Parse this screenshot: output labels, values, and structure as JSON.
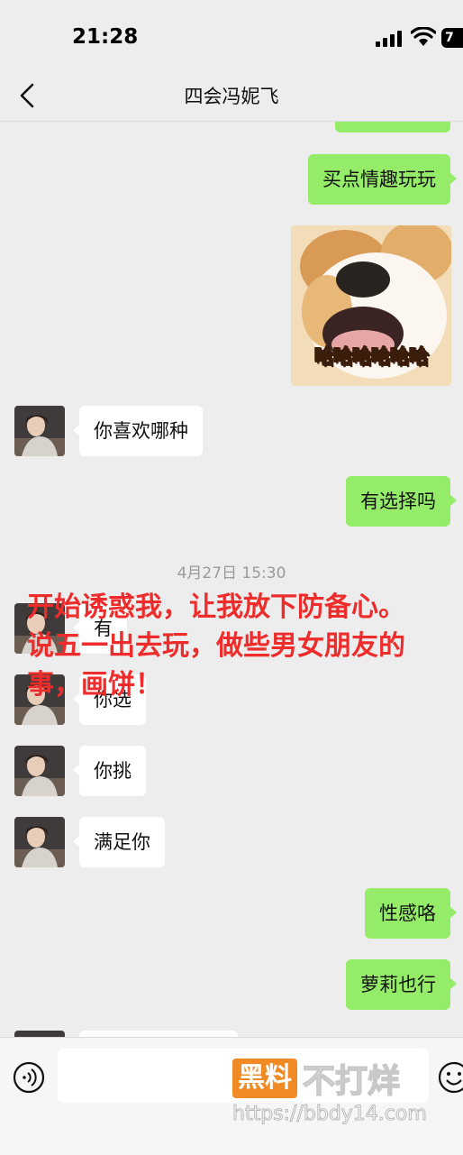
{
  "status_bar": {
    "time": "21:28",
    "battery": "7"
  },
  "header": {
    "title": "四会冯妮飞"
  },
  "messages": [
    {
      "side": "me",
      "text": "买点情趣玩玩"
    },
    {
      "side": "other",
      "text": "你喜欢哪种"
    },
    {
      "side": "me",
      "text": "有选择吗"
    },
    {
      "side": "other",
      "text": "有"
    },
    {
      "side": "other",
      "text": "你选"
    },
    {
      "side": "other",
      "text": "你挑"
    },
    {
      "side": "other",
      "text": "满足你"
    },
    {
      "side": "me",
      "text": "性感咯"
    },
    {
      "side": "me",
      "text": "萝莉也行"
    }
  ],
  "sticker": {
    "caption": "哈哈哈哈哈哈"
  },
  "timestamp": "4月27日 15:30",
  "annotation": "开始诱惑我，让我放下防备心。说五一出去玩，做些男女朋友的事，画饼！",
  "watermark": {
    "badge": "黑料",
    "text": "不打烊",
    "url": "https://bbdy14.com"
  },
  "colors": {
    "my_bubble": "#95ec69",
    "their_bubble": "#ffffff",
    "annotation": "#ee2c2c",
    "background": "#ededed"
  }
}
